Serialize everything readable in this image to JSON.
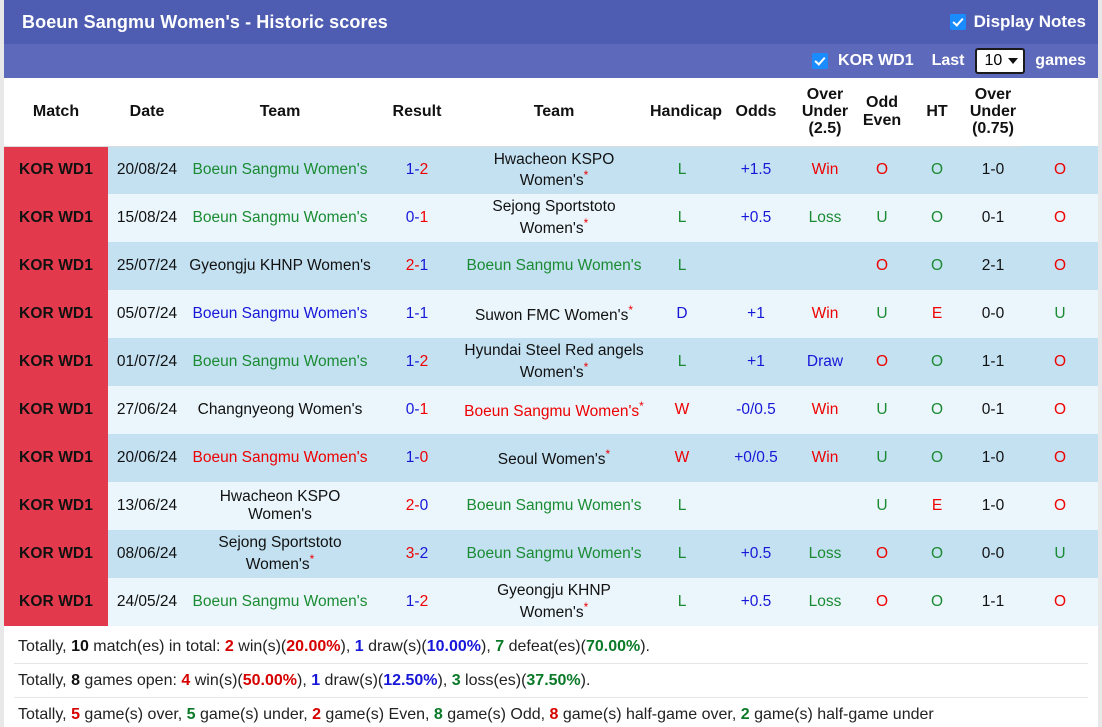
{
  "header": {
    "title": "Boeun Sangmu Women's - Historic scores",
    "display_notes_label": "Display Notes",
    "display_notes_checked": true,
    "league_label": "KOR WD1",
    "league_checked": true,
    "last_label": "Last",
    "games_label": "games",
    "games_count": "10",
    "title_bg": "#4e5cb2",
    "filter_bg": "#5d69ba",
    "checkbox_color": "#1a8cff"
  },
  "table": {
    "columns": [
      "Match",
      "Date",
      "Team",
      "Result",
      "Team",
      "Handicap",
      "Odds",
      "Over Under (2.5)",
      "Odd Even",
      "HT",
      "Over Under (0.75)"
    ],
    "columns_multiline": [
      [
        "Match"
      ],
      [
        "Date"
      ],
      [
        "Team"
      ],
      [
        "Result"
      ],
      [
        "Team"
      ],
      [
        "Handicap"
      ],
      [
        "Odds"
      ],
      [
        "Over",
        "Under",
        "(2.5)"
      ],
      [
        "Odd",
        "Even"
      ],
      [
        "HT"
      ],
      [
        "Over",
        "Under",
        "(0.75)"
      ]
    ],
    "rows": [
      {
        "match": "KOR WD1",
        "date": "20/08/24",
        "home": "Boeun Sangmu Women's",
        "home_color": "green",
        "home_star": false,
        "score_home": "1",
        "score_home_color": "blue",
        "score_away": "2",
        "score_away_color": "red",
        "away": "Hwacheon KSPO Women's",
        "away_color": "black",
        "away_star": true,
        "result": "L",
        "result_color": "green",
        "handicap": "+1.5",
        "handicap_color": "blue",
        "odds": "Win",
        "odds_color": "red",
        "ou25": "O",
        "ou25_color": "red",
        "oddeven": "O",
        "oddeven_color": "green",
        "ht": "1-0",
        "ou075": "O",
        "ou075_color": "red"
      },
      {
        "match": "KOR WD1",
        "date": "15/08/24",
        "home": "Boeun Sangmu Women's",
        "home_color": "green",
        "home_star": false,
        "score_home": "0",
        "score_home_color": "blue",
        "score_away": "1",
        "score_away_color": "red",
        "away": "Sejong Sportstoto Women's",
        "away_color": "black",
        "away_star": true,
        "result": "L",
        "result_color": "green",
        "handicap": "+0.5",
        "handicap_color": "blue",
        "odds": "Loss",
        "odds_color": "green",
        "ou25": "U",
        "ou25_color": "green",
        "oddeven": "O",
        "oddeven_color": "green",
        "ht": "0-1",
        "ou075": "O",
        "ou075_color": "red"
      },
      {
        "match": "KOR WD1",
        "date": "25/07/24",
        "home": "Gyeongju KHNP Women's",
        "home_color": "black",
        "home_star": false,
        "score_home": "2",
        "score_home_color": "red",
        "score_away": "1",
        "score_away_color": "blue",
        "away": "Boeun Sangmu Women's",
        "away_color": "green",
        "away_star": false,
        "result": "L",
        "result_color": "green",
        "handicap": "",
        "handicap_color": "blue",
        "odds": "",
        "odds_color": "red",
        "ou25": "O",
        "ou25_color": "red",
        "oddeven": "O",
        "oddeven_color": "green",
        "ht": "2-1",
        "ou075": "O",
        "ou075_color": "red"
      },
      {
        "match": "KOR WD1",
        "date": "05/07/24",
        "home": "Boeun Sangmu Women's",
        "home_color": "blue",
        "home_star": false,
        "score_home": "1",
        "score_home_color": "blue",
        "score_away": "1",
        "score_away_color": "blue",
        "away": "Suwon FMC Women's",
        "away_color": "black",
        "away_star": true,
        "result": "D",
        "result_color": "blue",
        "handicap": "+1",
        "handicap_color": "blue",
        "odds": "Win",
        "odds_color": "red",
        "ou25": "U",
        "ou25_color": "green",
        "oddeven": "E",
        "oddeven_color": "red",
        "ht": "0-0",
        "ou075": "U",
        "ou075_color": "green"
      },
      {
        "match": "KOR WD1",
        "date": "01/07/24",
        "home": "Boeun Sangmu Women's",
        "home_color": "green",
        "home_star": false,
        "score_home": "1",
        "score_home_color": "blue",
        "score_away": "2",
        "score_away_color": "red",
        "away": "Hyundai Steel Red angels Women's",
        "away_color": "black",
        "away_star": true,
        "result": "L",
        "result_color": "green",
        "handicap": "+1",
        "handicap_color": "blue",
        "odds": "Draw",
        "odds_color": "blue",
        "ou25": "O",
        "ou25_color": "red",
        "oddeven": "O",
        "oddeven_color": "green",
        "ht": "1-1",
        "ou075": "O",
        "ou075_color": "red"
      },
      {
        "match": "KOR WD1",
        "date": "27/06/24",
        "home": "Changnyeong Women's",
        "home_color": "black",
        "home_star": false,
        "score_home": "0",
        "score_home_color": "blue",
        "score_away": "1",
        "score_away_color": "red",
        "away": "Boeun Sangmu Women's",
        "away_color": "red",
        "away_star": true,
        "result": "W",
        "result_color": "red",
        "handicap": "-0/0.5",
        "handicap_color": "blue",
        "odds": "Win",
        "odds_color": "red",
        "ou25": "U",
        "ou25_color": "green",
        "oddeven": "O",
        "oddeven_color": "green",
        "ht": "0-1",
        "ou075": "O",
        "ou075_color": "red"
      },
      {
        "match": "KOR WD1",
        "date": "20/06/24",
        "home": "Boeun Sangmu Women's",
        "home_color": "red",
        "home_star": false,
        "score_home": "1",
        "score_home_color": "blue",
        "score_away": "0",
        "score_away_color": "red",
        "away": "Seoul Women's",
        "away_color": "black",
        "away_star": true,
        "result": "W",
        "result_color": "red",
        "handicap": "+0/0.5",
        "handicap_color": "blue",
        "odds": "Win",
        "odds_color": "red",
        "ou25": "U",
        "ou25_color": "green",
        "oddeven": "O",
        "oddeven_color": "green",
        "ht": "1-0",
        "ou075": "O",
        "ou075_color": "red"
      },
      {
        "match": "KOR WD1",
        "date": "13/06/24",
        "home": "Hwacheon KSPO Women's",
        "home_color": "black",
        "home_star": false,
        "score_home": "2",
        "score_home_color": "red",
        "score_away": "0",
        "score_away_color": "blue",
        "away": "Boeun Sangmu Women's",
        "away_color": "green",
        "away_star": false,
        "result": "L",
        "result_color": "green",
        "handicap": "",
        "handicap_color": "blue",
        "odds": "",
        "odds_color": "green",
        "ou25": "U",
        "ou25_color": "green",
        "oddeven": "E",
        "oddeven_color": "red",
        "ht": "1-0",
        "ou075": "O",
        "ou075_color": "red"
      },
      {
        "match": "KOR WD1",
        "date": "08/06/24",
        "home": "Sejong Sportstoto Women's",
        "home_color": "black",
        "home_star": true,
        "score_home": "3",
        "score_home_color": "red",
        "score_away": "2",
        "score_away_color": "blue",
        "away": "Boeun Sangmu Women's",
        "away_color": "green",
        "away_star": false,
        "result": "L",
        "result_color": "green",
        "handicap": "+0.5",
        "handicap_color": "blue",
        "odds": "Loss",
        "odds_color": "green",
        "ou25": "O",
        "ou25_color": "red",
        "oddeven": "O",
        "oddeven_color": "green",
        "ht": "0-0",
        "ou075": "U",
        "ou075_color": "green"
      },
      {
        "match": "KOR WD1",
        "date": "24/05/24",
        "home": "Boeun Sangmu Women's",
        "home_color": "green",
        "home_star": false,
        "score_home": "1",
        "score_home_color": "blue",
        "score_away": "2",
        "score_away_color": "red",
        "away": "Gyeongju KHNP Women's",
        "away_color": "black",
        "away_star": true,
        "result": "L",
        "result_color": "green",
        "handicap": "+0.5",
        "handicap_color": "blue",
        "odds": "Loss",
        "odds_color": "green",
        "ou25": "O",
        "ou25_color": "red",
        "oddeven": "O",
        "oddeven_color": "green",
        "ht": "1-1",
        "ou075": "O",
        "ou075_color": "red"
      }
    ]
  },
  "footer": {
    "line1": [
      {
        "t": "Totally, ",
        "c": "plain"
      },
      {
        "t": "10",
        "c": "k"
      },
      {
        "t": " match(es) in total: ",
        "c": "plain"
      },
      {
        "t": "2",
        "c": "r"
      },
      {
        "t": " win(s)(",
        "c": "plain"
      },
      {
        "t": "20.00%",
        "c": "r"
      },
      {
        "t": "), ",
        "c": "plain"
      },
      {
        "t": "1",
        "c": "b"
      },
      {
        "t": " draw(s)(",
        "c": "plain"
      },
      {
        "t": "10.00%",
        "c": "b"
      },
      {
        "t": "), ",
        "c": "plain"
      },
      {
        "t": "7",
        "c": "g"
      },
      {
        "t": " defeat(es)(",
        "c": "plain"
      },
      {
        "t": "70.00%",
        "c": "g"
      },
      {
        "t": ").",
        "c": "plain"
      }
    ],
    "line2": [
      {
        "t": "Totally, ",
        "c": "plain"
      },
      {
        "t": "8",
        "c": "k"
      },
      {
        "t": " games open: ",
        "c": "plain"
      },
      {
        "t": "4",
        "c": "r"
      },
      {
        "t": " win(s)(",
        "c": "plain"
      },
      {
        "t": "50.00%",
        "c": "r"
      },
      {
        "t": "), ",
        "c": "plain"
      },
      {
        "t": "1",
        "c": "b"
      },
      {
        "t": " draw(s)(",
        "c": "plain"
      },
      {
        "t": "12.50%",
        "c": "b"
      },
      {
        "t": "), ",
        "c": "plain"
      },
      {
        "t": "3",
        "c": "g"
      },
      {
        "t": " loss(es)(",
        "c": "plain"
      },
      {
        "t": "37.50%",
        "c": "g"
      },
      {
        "t": ").",
        "c": "plain"
      }
    ],
    "line3": [
      {
        "t": "Totally, ",
        "c": "plain"
      },
      {
        "t": "5",
        "c": "r"
      },
      {
        "t": " game(s) over, ",
        "c": "plain"
      },
      {
        "t": "5",
        "c": "g"
      },
      {
        "t": " game(s) under, ",
        "c": "plain"
      },
      {
        "t": "2",
        "c": "r"
      },
      {
        "t": " game(s) Even, ",
        "c": "plain"
      },
      {
        "t": "8",
        "c": "g"
      },
      {
        "t": " game(s) Odd, ",
        "c": "plain"
      },
      {
        "t": "8",
        "c": "r"
      },
      {
        "t": " game(s) half-game over, ",
        "c": "plain"
      },
      {
        "t": "2",
        "c": "g"
      },
      {
        "t": " game(s) half-game under",
        "c": "plain"
      }
    ]
  }
}
